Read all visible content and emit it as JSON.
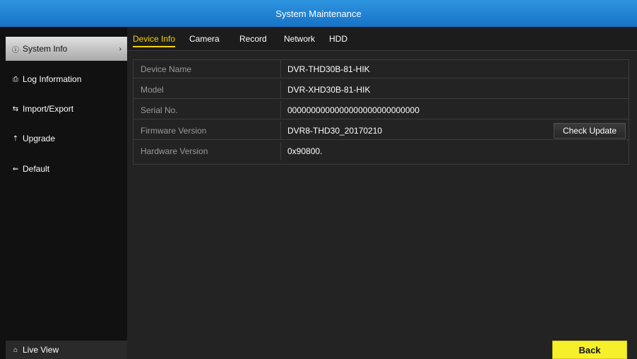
{
  "window": {
    "title": "System Maintenance"
  },
  "sidebar": {
    "items": [
      {
        "label": "System Info",
        "icon": "info-icon",
        "glyph": "ⓘ"
      },
      {
        "label": "Log Information",
        "icon": "log-icon",
        "glyph": "⎙"
      },
      {
        "label": "Import/Export",
        "icon": "import-export-icon",
        "glyph": "⇆"
      },
      {
        "label": "Upgrade",
        "icon": "upgrade-icon",
        "glyph": "⇡"
      },
      {
        "label": "Default",
        "icon": "default-icon",
        "glyph": "⇐"
      }
    ],
    "live_view": {
      "label": "Live View",
      "icon": "home-icon",
      "glyph": "⌂"
    },
    "arrow_glyph": "›"
  },
  "tabs": [
    {
      "label": "Device Info"
    },
    {
      "label": "Camera"
    },
    {
      "label": "Record"
    },
    {
      "label": "Network"
    },
    {
      "label": "HDD"
    }
  ],
  "device_info": {
    "rows": [
      {
        "label": "Device Name",
        "value": "DVR-THD30B-81-HIK"
      },
      {
        "label": "Model",
        "value": "DVR-XHD30B-81-HIK"
      },
      {
        "label": "Serial No.",
        "value": "0000000000000000000000000000"
      },
      {
        "label": "Firmware Version",
        "value": "DVR8-THD30_20170210"
      },
      {
        "label": "Hardware Version",
        "value": "0x90800."
      }
    ],
    "check_update_label": "Check Update"
  },
  "footer": {
    "back_label": "Back"
  },
  "colors": {
    "title_bar": "#1c82d4",
    "active_tab": "#f5d300",
    "back_button": "#f6f02a"
  }
}
